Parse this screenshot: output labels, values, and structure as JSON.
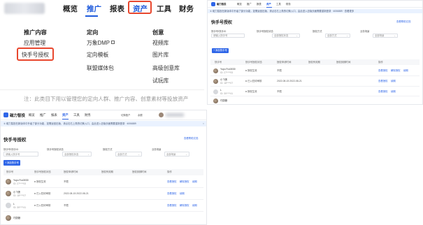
{
  "panel_menu": {
    "nav": [
      "概览",
      "推广",
      "报表",
      "资产",
      "工具",
      "财务"
    ],
    "active_nav": "推广",
    "highlighted_nav": "资产",
    "columns": [
      {
        "items": [
          "推广内容",
          "应用管理",
          "快手号授权"
        ]
      },
      {
        "items": [
          "定向",
          "万象DMP",
          "定向模板",
          "联盟媒体包"
        ]
      },
      {
        "items": [
          "创意",
          "视频库",
          "图片库",
          "高级创意库",
          "试玩库"
        ]
      }
    ],
    "highlighted_item": "快手号授权",
    "footer_note": "注：此类目下用以管理您的定向人群、推广内容、创意素材等投放资产"
  },
  "panel_top_right": {
    "brand": "磁力智投",
    "nav": [
      "概览",
      "推广",
      "报表",
      "资产",
      "工具",
      "财务"
    ],
    "active_nav": "资产",
    "notice": "① 磁力智投在新版本中升级了部分功能，如需返回旧版，请点击右上角的切换入口，由此进入旧版页面需要重新登录 · 4006889 · 查看更多",
    "title": "快手号授权",
    "help": "查看帮助文档",
    "filters": [
      {
        "label": "快手号/快手ID",
        "value": "请输入快手号"
      },
      {
        "label": "快手号授权状态",
        "value": "全部授权状态"
      },
      {
        "label": "授权方式",
        "value": "全部方式"
      },
      {
        "label": "业务场景",
        "value": "全部场景"
      }
    ],
    "add_button": "+ 添加快手号",
    "columns": [
      "快手号",
      "快手号授权状态",
      "授权申请时间",
      "授权有效期",
      "授权到期时间",
      "操作"
    ],
    "rows": [
      {
        "name": "Yuyu Fox3030",
        "id": "ID: 27****93",
        "status": "授权生效",
        "time": "不限",
        "ops": [
          "查看授权",
          "解除授权",
          "续期"
        ]
      },
      {
        "name": "小飞侠",
        "id": "ID: 18****07",
        "status": "已入驻待审核",
        "time": "2022-08-15 2022-08-21",
        "ops": [
          "查看授权",
          "续期"
        ]
      },
      {
        "name": "L",
        "id": "ID: 30****41",
        "status": "授权生效",
        "time": "不限",
        "ops": [
          "查看授权",
          "续期"
        ]
      },
      {
        "name": "巧厨娘",
        "id": "ID: 16****62",
        "status": "",
        "time": "",
        "ops": []
      }
    ]
  },
  "panel_bottom": {
    "brand": "磁力智投",
    "nav": [
      "概览",
      "推广",
      "报表",
      "资产",
      "工具",
      "财务"
    ],
    "active_nav": "资产",
    "account_text": "切换账户",
    "balance_text": "余额",
    "notice": "① 磁力智投在新版本中升级了部分功能，如需返回旧版，请点击右上角的切换入口，由此进入旧版页面需要重新登录 · 4006889",
    "title": "快手号授权",
    "help": "查看帮助文档",
    "filters": [
      {
        "label": "快手号/快手ID",
        "value": "请输入快手号"
      },
      {
        "label": "快手号授权状态",
        "value": "全部授权状态"
      },
      {
        "label": "授权方式",
        "value": "全部方式"
      },
      {
        "label": "业务场景",
        "value": "全部场景"
      }
    ],
    "add_button": "+ 添加快手号",
    "columns": [
      "快手号",
      "快手号授权状态",
      "授权申请时间",
      "授权有效期",
      "授权到期时间",
      "操作"
    ],
    "rows": [
      {
        "name": "Yuyu Fox3030",
        "id": "ID: 27****93",
        "status": "授权生效",
        "time": "不限",
        "ops": [
          "查看授权",
          "解除授权",
          "续期"
        ]
      },
      {
        "name": "小飞侠",
        "id": "ID: 18****07",
        "status": "已入驻待审核",
        "time": "2022-08-15 2022-08-21",
        "ops": [
          "查看授权",
          "续期"
        ]
      },
      {
        "name": "L",
        "id": "ID: 30****41",
        "status": "已入驻待审核",
        "time": "不限",
        "ops": [
          "查看授权",
          "解除授权",
          "续期"
        ]
      },
      {
        "name": "巧厨娘",
        "id": "ID: 16****62",
        "status": "",
        "time": "",
        "ops": []
      }
    ]
  },
  "colors": {
    "brand_blue": "#2f66e8",
    "highlight_red": "#e8472e",
    "notice_bg": "#eaf2ff"
  }
}
